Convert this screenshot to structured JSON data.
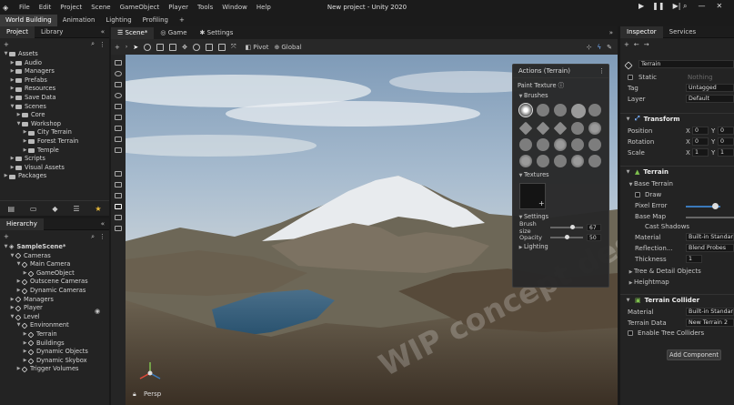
{
  "menu": {
    "items": [
      "File",
      "Edit",
      "Project",
      "Scene",
      "GameObject",
      "Player",
      "Tools",
      "Window",
      "Help"
    ],
    "title": "New project - Unity 2020"
  },
  "layouts": {
    "tabs": [
      "World Building",
      "Animation",
      "Lighting",
      "Profiling"
    ],
    "add": "+"
  },
  "project_panel": {
    "tabs": [
      "Project",
      "Library"
    ],
    "tree": [
      {
        "label": "Assets",
        "depth": 0,
        "icon": "folder-icon",
        "open": true
      },
      {
        "label": "Audio",
        "depth": 1,
        "icon": "folder-icon"
      },
      {
        "label": "Managers",
        "depth": 1,
        "icon": "folder-icon"
      },
      {
        "label": "Prefabs",
        "depth": 1,
        "icon": "folder-icon"
      },
      {
        "label": "Resources",
        "depth": 1,
        "icon": "folder-icon"
      },
      {
        "label": "Save Data",
        "depth": 1,
        "icon": "folder-icon"
      },
      {
        "label": "Scenes",
        "depth": 1,
        "icon": "folder-icon",
        "open": true
      },
      {
        "label": "Core",
        "depth": 2,
        "icon": "folder-icon"
      },
      {
        "label": "Workshop",
        "depth": 2,
        "icon": "folder-icon",
        "open": true
      },
      {
        "label": "City Terrain",
        "depth": 3,
        "icon": "folder-icon"
      },
      {
        "label": "Forest Terrain",
        "depth": 3,
        "icon": "folder-icon"
      },
      {
        "label": "Temple",
        "depth": 3,
        "icon": "folder-icon"
      },
      {
        "label": "Scripts",
        "depth": 1,
        "icon": "folder-icon"
      },
      {
        "label": "Visual Assets",
        "depth": 1,
        "icon": "folder-icon"
      },
      {
        "label": "Packages",
        "depth": 0,
        "icon": "folder-icon"
      }
    ]
  },
  "hierarchy_panel": {
    "tabs": [
      "Hierarchy"
    ],
    "tree": [
      {
        "label": "SampleScene*",
        "depth": 0,
        "icon": "scene-icon",
        "open": true,
        "bold": true
      },
      {
        "label": "Cameras",
        "depth": 1,
        "icon": "cube-icon",
        "open": true
      },
      {
        "label": "Main Camera",
        "depth": 2,
        "icon": "cube-icon",
        "open": true
      },
      {
        "label": "GameObject",
        "depth": 3,
        "icon": "cube-icon"
      },
      {
        "label": "Outscene Cameras",
        "depth": 2,
        "icon": "cube-icon"
      },
      {
        "label": "Dynamic Cameras",
        "depth": 2,
        "icon": "cube-icon"
      },
      {
        "label": "Managers",
        "depth": 1,
        "icon": "cube-icon"
      },
      {
        "label": "Player",
        "depth": 1,
        "icon": "cube-icon"
      },
      {
        "label": "Level",
        "depth": 1,
        "icon": "cube-icon",
        "open": true
      },
      {
        "label": "Environment",
        "depth": 2,
        "icon": "cube-icon",
        "open": true
      },
      {
        "label": "Terrain",
        "depth": 3,
        "icon": "cube-icon"
      },
      {
        "label": "Buildings",
        "depth": 3,
        "icon": "cube-icon"
      },
      {
        "label": "Dynamic Objects",
        "depth": 3,
        "icon": "cube-icon"
      },
      {
        "label": "Dynamic Skybox",
        "depth": 3,
        "icon": "cube-icon"
      },
      {
        "label": "Trigger Volumes",
        "depth": 2,
        "icon": "cube-icon"
      }
    ]
  },
  "scene": {
    "tabs": [
      "Scene*",
      "Game",
      "Settings"
    ],
    "pivot": "Pivot",
    "global": "Global",
    "persp": "Persp",
    "watermark": "WIP concept design by"
  },
  "actions_overlay": {
    "title": "Actions (Terrain)",
    "paint_texture": "Paint Texture",
    "brushes": "Brushes",
    "textures": "Textures",
    "settings": "Settings",
    "brush_size_label": "Brush size",
    "brush_size": "67",
    "opacity_label": "Opacity",
    "opacity": "50",
    "brush_size_fraction": 0.67,
    "opacity_fraction": 0.5,
    "lighting": "Lighting"
  },
  "inspector": {
    "tabs": [
      "Inspector",
      "Services"
    ],
    "object_name": "Terrain",
    "static_label": "Static",
    "static_value": "Nothing",
    "tag_label": "Tag",
    "tag_value": "Untagged",
    "layer_label": "Layer",
    "layer_value": "Default",
    "transform": {
      "title": "Transform",
      "position_label": "Position",
      "rotation_label": "Rotation",
      "scale_label": "Scale",
      "position": {
        "x": "0",
        "y": "0"
      },
      "rotation": {
        "x": "0",
        "y": "0"
      },
      "scale": {
        "x": "1",
        "y": "1"
      }
    },
    "terrain": {
      "title": "Terrain",
      "base_terrain": "Base Terrain",
      "draw": "Draw",
      "pixel_error": "Pixel Error",
      "base_map": "Base Map",
      "cast_shadows": "Cast Shadows",
      "material_label": "Material",
      "material_value": "Built-in Standard",
      "reflection_label": "Reflection...",
      "reflection_value": "Blend Probes",
      "thickness_label": "Thickness",
      "thickness_value": "1",
      "tree_detail": "Tree & Detail Objects",
      "heightmap": "Heightmap"
    },
    "collider": {
      "title": "Terrain Collider",
      "material_label": "Material",
      "material_value": "Built-in Standard",
      "terrain_data_label": "Terrain Data",
      "terrain_data_value": "New Terrain 2",
      "enable_trees": "Enable Tree Colliders"
    },
    "add_component": "Add Component"
  },
  "colors": {
    "accent": "#3a79bb",
    "panel": "#232323",
    "header": "#1b1b1b"
  }
}
